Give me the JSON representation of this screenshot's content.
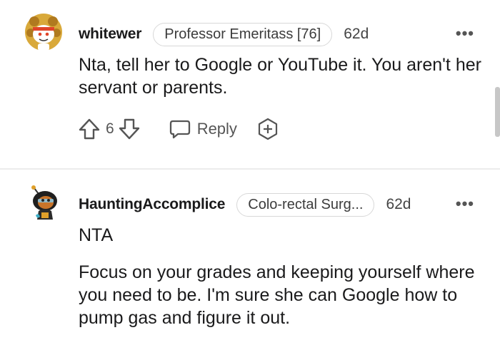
{
  "comments": [
    {
      "username": "whitewer",
      "flair": "Professor Emeritass [76]",
      "age": "62d",
      "more_icon": "more-horizontal-icon",
      "paragraphs": [
        "Nta, tell her to Google or YouTube it. You aren't her servant or parents."
      ],
      "vote_count": "6",
      "reply_label": "Reply"
    },
    {
      "username": "HauntingAccomplice",
      "flair": "Colo-rectal Surg...",
      "age": "62d",
      "more_icon": "more-horizontal-icon",
      "paragraphs": [
        "NTA",
        "Focus on your grades and keeping yourself where you need to be. I'm sure she can Google how to pump gas and figure it out."
      ]
    }
  ],
  "icons": {
    "upvote": "upvote-arrow-icon",
    "downvote": "downvote-arrow-icon",
    "reply": "speech-bubble-icon",
    "award": "award-plus-icon"
  },
  "colors": {
    "text": "#1a1a1b",
    "meta": "#555555",
    "flair_border": "#d8d8d8"
  }
}
